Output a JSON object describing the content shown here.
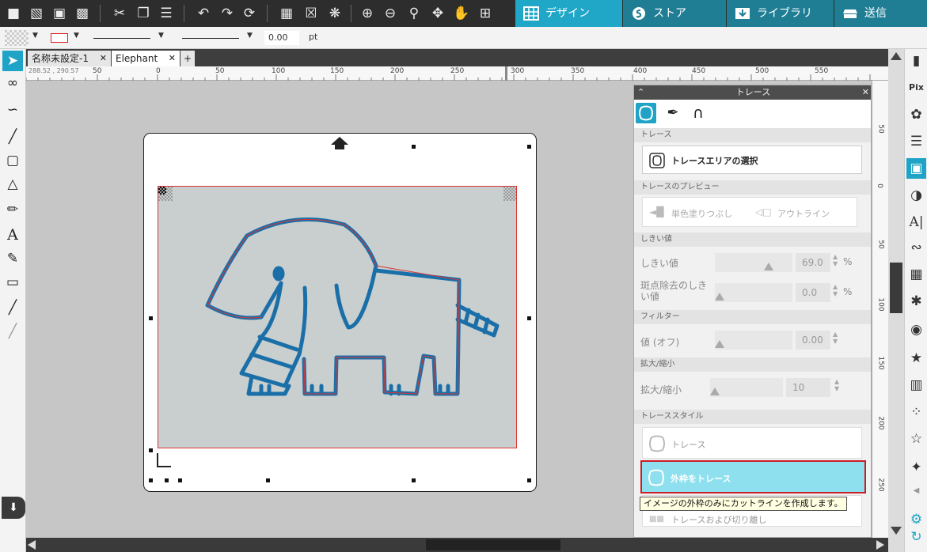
{
  "toolbar": {
    "tabs": [
      {
        "label": "デザイン",
        "icon": "grid-icon",
        "active": true
      },
      {
        "label": "ストア",
        "icon": "store-icon",
        "active": false
      },
      {
        "label": "ライブラリ",
        "icon": "library-icon",
        "active": false
      },
      {
        "label": "送信",
        "icon": "cutter-icon",
        "active": false
      }
    ]
  },
  "options_bar": {
    "line_width_value": "0.00",
    "line_width_unit": "pt"
  },
  "doc_tabs": [
    {
      "label": "名称未設定-1",
      "active": false
    },
    {
      "label": "Elephant",
      "active": true
    }
  ],
  "ruler": {
    "cursor_readout": "288.52 , 290.57",
    "ticks": [
      "50",
      "0",
      "50",
      "100",
      "150",
      "200",
      "250",
      "300",
      "350",
      "400",
      "450",
      "500",
      "550"
    ],
    "vticks": [
      "50",
      "0",
      "50",
      "100",
      "150",
      "200",
      "250"
    ]
  },
  "trace_panel": {
    "title": "トレース",
    "section_trace": "トレース",
    "select_area_label": "トレースエリアの選択",
    "section_preview": "トレースのプレビュー",
    "preview_fill_label": "単色塗りつぶし",
    "preview_outline_label": "アウトライン",
    "section_threshold": "しきい値",
    "threshold_label": "しきい値",
    "threshold_value": "69.0",
    "threshold_unit": "%",
    "threshold_level": 0.69,
    "despeckle_label": "斑点除去のしきい値",
    "despeckle_value": "0.0",
    "despeckle_unit": "%",
    "section_filter": "フィルター",
    "filter_label": "値 (オフ)",
    "filter_value": "0.00",
    "section_scale": "拡大/縮小",
    "scale_label": "拡大/縮小",
    "scale_value": "10",
    "section_style": "トレーススタイル",
    "style_trace_label": "トレース",
    "style_outer_label": "外枠をトレース",
    "style_trace_cut_label": "トレースおよび切り離し",
    "tooltip": "イメージの外枠のみにカットラインを作成します。"
  },
  "colors": {
    "accent": "#20a7c8",
    "nav_tab": "#1f7e94",
    "highlight_button": "#8ee0ee",
    "highlight_border": "#cc1c24",
    "elephant_stroke": "#1b6fa8"
  }
}
